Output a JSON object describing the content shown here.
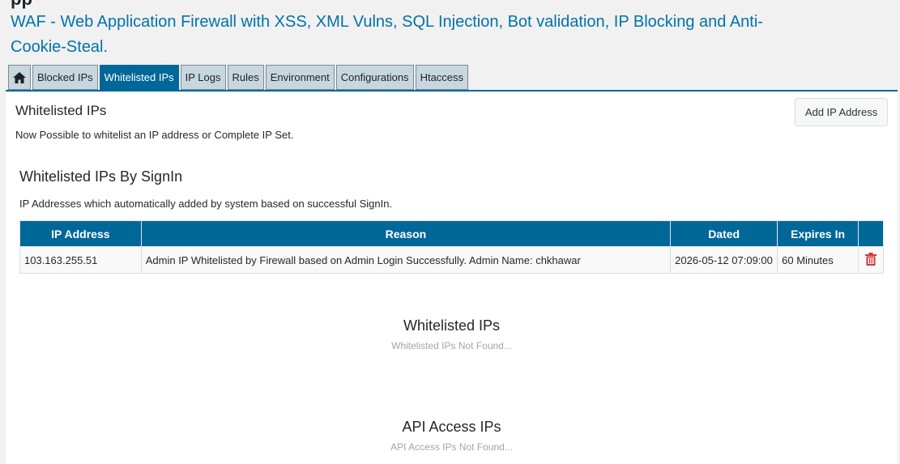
{
  "header": {
    "title_fragment": "pp",
    "subtitle": "WAF - Web Application Firewall with XSS, XML Vulns, SQL Injection, Bot validation, IP Blocking and Anti-Cookie-Steal."
  },
  "tabs": [
    {
      "label": "",
      "icon": "home-icon"
    },
    {
      "label": "Blocked IPs"
    },
    {
      "label": "Whitelisted IPs",
      "active": true
    },
    {
      "label": "IP Logs"
    },
    {
      "label": "Rules"
    },
    {
      "label": "Environment"
    },
    {
      "label": "Configurations"
    },
    {
      "label": "Htaccess"
    }
  ],
  "panel": {
    "title": "Whitelisted IPs",
    "description": "Now Possible to whitelist an IP address or Complete IP Set.",
    "add_button": "Add IP Address"
  },
  "signin_section": {
    "title": "Whitelisted IPs By SignIn",
    "description": "IP Addresses which automatically added by system based on successful SignIn.",
    "columns": [
      "IP Address",
      "Reason",
      "Dated",
      "Expires In",
      ""
    ],
    "rows": [
      {
        "ip": "103.163.255.51",
        "reason": "Admin IP Whitelisted by Firewall based on Admin Login Successfully. Admin Name: chkhawar",
        "dated": "2026-05-12 07:09:00",
        "expires": "60 Minutes",
        "action_icon": "trash-icon"
      }
    ]
  },
  "whitelisted_section": {
    "title": "Whitelisted IPs",
    "empty": "Whitelisted IPs Not Found..."
  },
  "api_section": {
    "title": "API Access IPs",
    "empty": "API Access IPs Not Found..."
  },
  "colors": {
    "accent": "#006799",
    "link": "#0073aa",
    "delete": "#d63638",
    "tab_bg": "#c7d7df"
  }
}
